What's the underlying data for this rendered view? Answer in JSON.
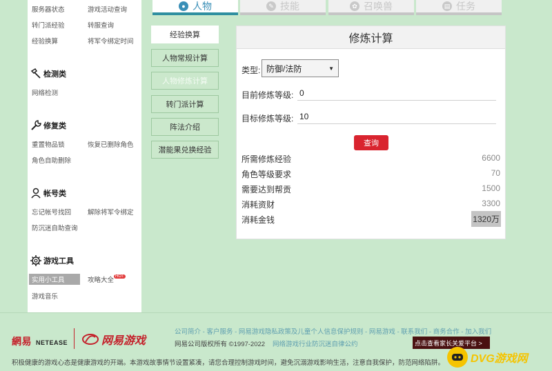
{
  "sidebar": {
    "row1": [
      "服务器状态",
      "游戏活动查询"
    ],
    "row2": [
      "转门派经验",
      "转服查询"
    ],
    "row3": [
      "经验换算",
      "将军令绑定时间"
    ],
    "detect": {
      "title": "检测类",
      "items": [
        "网络检测"
      ]
    },
    "repair": {
      "title": "修复类",
      "items": [
        "重置物品锁",
        "恢复已删除角色",
        "角色自助删除"
      ]
    },
    "account": {
      "title": "帐号类",
      "items": [
        "忘记帐号找回",
        "解除将军令绑定",
        "防沉迷自助查询"
      ]
    },
    "tools": {
      "title": "游戏工具",
      "items": [
        "实用小工具",
        "攻略大全",
        "游戏音乐"
      ],
      "badge": "HOT"
    }
  },
  "tabs": [
    "人物",
    "技能",
    "召唤兽",
    "任务"
  ],
  "menu": [
    "经验换算",
    "人物常规计算",
    "人物修炼计算",
    "转门派计算",
    "阵法介绍",
    "潜能果兑换经验"
  ],
  "panel": {
    "title": "修炼计算",
    "type_label": "类型:",
    "type_value": "防御/法防",
    "current_label": "目前修炼等级:",
    "current_value": "0",
    "target_label": "目标修炼等级:",
    "target_value": "10",
    "query_label": "查询",
    "results": [
      {
        "label": "所需修炼经验",
        "value": "6600"
      },
      {
        "label": "角色等级要求",
        "value": "70"
      },
      {
        "label": "需要达到帮贡",
        "value": "1500"
      },
      {
        "label": "消耗资财",
        "value": "3300"
      },
      {
        "label": "消耗金钱",
        "value": "1320万"
      }
    ]
  },
  "footer": {
    "logo_netease": "網易",
    "logo_netease_en": "NETEASE",
    "logo_games": "网易游戏",
    "links": "公司简介 - 客户服务 - 网易游戏隐私政策及儿童个人信息保护规则 - 网易游戏 - 联系我们 - 商务合作 - 加入我们",
    "copyright": "网易公司版权所有 ©1997-2022",
    "self_discipline": "网络游戏行业防沉迷自律公约",
    "parent_platform": "点击查看家长关爱平台 >",
    "notice": "积极健康的游戏心态是健康游戏的开端。本游戏故事情节设置紧凑，请您合理控制游戏时间，避免沉溺游戏影响生活，注意自我保护，防范网络陷阱。",
    "watermark": "DVG游戏网"
  },
  "colors": {
    "bg": "#c9e8cc",
    "accent": "#3a8fb7",
    "query": "#d9242f",
    "brand": "#c4212b"
  }
}
